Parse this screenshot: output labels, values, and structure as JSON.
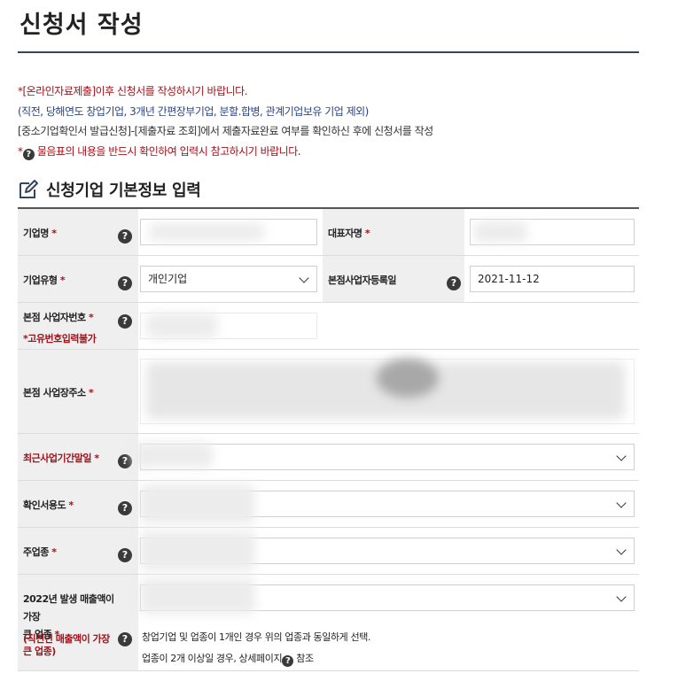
{
  "page": {
    "title": "신청서 작성"
  },
  "notice": {
    "line1": "*[온라인자료제출]이후 신청서를 작성하시기 바랍니다.",
    "line2": "(직전, 당해연도 창업기업, 3개년 간편장부기업, 분할.합병, 관계기업보유 기업 제외)",
    "line3": "[중소기업확인서 발급신청]-[제출자료 조회]에서 제출자료완료 여부를 확인하신 후에 신청서를 작성",
    "line4_prefix": "*",
    "line4_text": "물음표의 내용을 반드시 확인하여 입력시 참고하시기 바랍니다."
  },
  "section": {
    "title": "신청기업 기본정보 입력",
    "icon": "edit-icon"
  },
  "form": {
    "company_name": {
      "label": "기업명",
      "required": "*"
    },
    "ceo_name": {
      "label": "대표자명",
      "required": "*"
    },
    "company_type": {
      "label": "기업유형",
      "required": "*",
      "value": "개인기업"
    },
    "reg_date": {
      "label": "본점사업자등록일",
      "value": "2021-11-12"
    },
    "biz_number": {
      "label": "본점 사업자번호",
      "required": "*",
      "note": "*고유번호입력불가"
    },
    "address": {
      "label": "본점 사업장주소",
      "required": "*"
    },
    "fiscal_end": {
      "label": "최근사업기간말일",
      "required": "*"
    },
    "purpose": {
      "label": "확인서용도",
      "required": "*"
    },
    "main_industry": {
      "label": "주업종",
      "required": "*"
    },
    "top_sales_industry": {
      "label_line1": "2022년 발생 매출액이 가장",
      "label_line2": "큰 업종",
      "required": "*",
      "note": "(직전년 매출액이 가장 큰 업종)",
      "help1": "창업기업 및 업종이 1개인 경우 위의 업종과 동일하게 선택.",
      "help2_prefix": "업종이 2개 이상일 경우, 상세페이지",
      "help2_suffix": "참조"
    }
  },
  "icons": {
    "help": "?"
  },
  "colors": {
    "accent_red": "#a1121b",
    "navy": "#2b4487",
    "rule": "#34455e"
  }
}
